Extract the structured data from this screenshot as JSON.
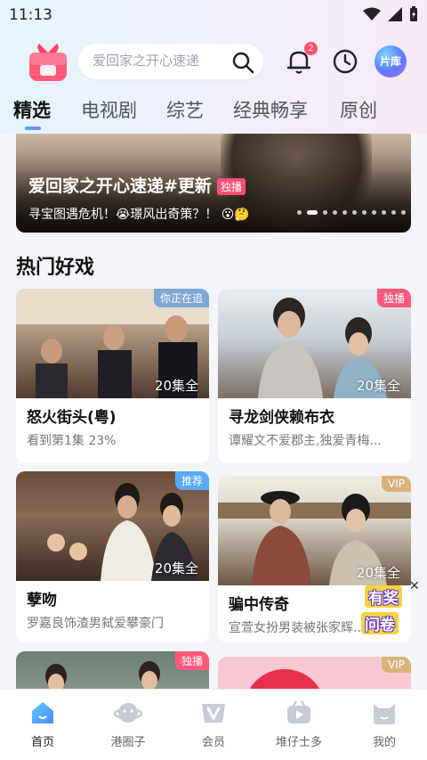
{
  "status_bar": {
    "time": "11:13"
  },
  "header": {
    "search_placeholder": "爱回家之开心速递",
    "notification_count": "2",
    "library_label": "片库"
  },
  "tabs": [
    {
      "label": "精选",
      "active": true
    },
    {
      "label": "电视剧",
      "active": false
    },
    {
      "label": "综艺",
      "active": false
    },
    {
      "label": "经典畅享",
      "active": false
    },
    {
      "label": "原创",
      "active": false
    }
  ],
  "banner": {
    "title": "爱回家之开心速递#更新",
    "badge": "独播",
    "subtitle": "寻宝图遇危机！😭璟风出奇策？！ 😮🤔",
    "slide_count": 11,
    "active_slide": 1
  },
  "section": {
    "title": "热门好戏"
  },
  "cards": [
    {
      "title": "怒火街头(粤)",
      "subtitle": "看到第1集 23%",
      "episodes": "20集全",
      "tag": "你正在追",
      "tag_color": "#7fa7d6"
    },
    {
      "title": "寻龙剑侠赖布衣",
      "subtitle": "谭耀文不爱郡主,独爱青梅...",
      "episodes": "20集全",
      "tag": "独播",
      "tag_color": "#ff5a7a"
    },
    {
      "title": "孽吻",
      "subtitle": "罗嘉良饰渣男弑爱攀豪门",
      "episodes": "20集全",
      "tag": "推荐",
      "tag_color": "#5aa9f5"
    },
    {
      "title": "骗中传奇",
      "subtitle": "宣萱女扮男装被张家辉...",
      "episodes": "20集全",
      "tag": "VIP",
      "tag_color": "#d9b27a"
    },
    {
      "tag": "独播",
      "tag_color": "#ff5a7a"
    },
    {
      "tag": "VIP",
      "tag_color": "#d9b27a"
    }
  ],
  "promo": {
    "line1": "有奖",
    "line2": "问卷",
    "close": "✕"
  },
  "bottom_nav": [
    {
      "label": "首页",
      "active": true
    },
    {
      "label": "港圈子",
      "active": false
    },
    {
      "label": "会员",
      "active": false
    },
    {
      "label": "堆仔士多",
      "active": false
    },
    {
      "label": "我的",
      "active": false
    }
  ]
}
